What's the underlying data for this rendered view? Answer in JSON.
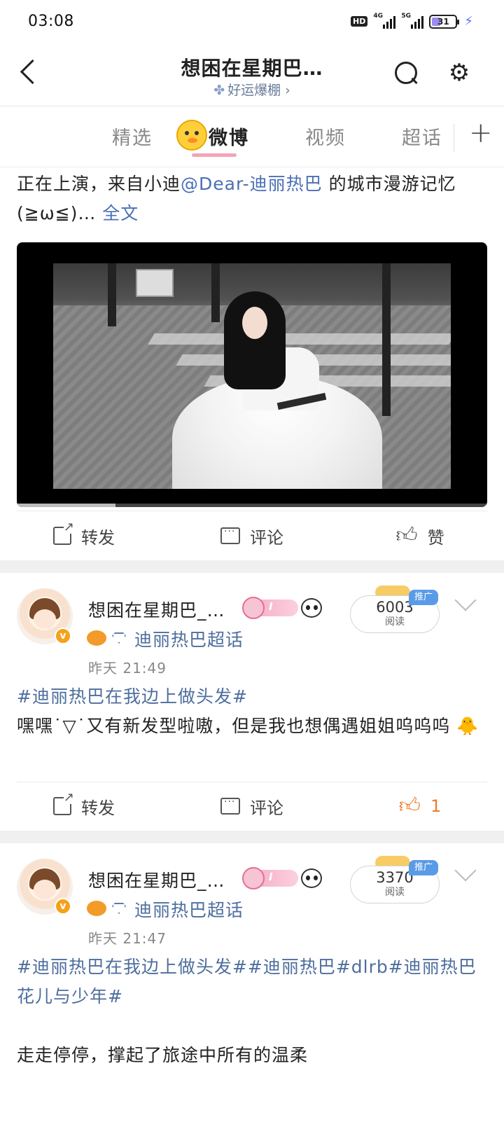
{
  "status_bar": {
    "time": "03:08",
    "hd": "HD",
    "net1": "4G",
    "net2": "5G",
    "battery": "31"
  },
  "header": {
    "title": "想困在星期巴…",
    "subtitle": "好运爆棚 ›"
  },
  "tabs": [
    {
      "label": "精选"
    },
    {
      "label": "微博"
    },
    {
      "label": "视频"
    },
    {
      "label": "超话"
    }
  ],
  "post1": {
    "text_before": "正在上演，来自小迪",
    "mention": "@Dear-迪丽热巴",
    "text_after": " 的城市漫游记忆(≧ω≦)…",
    "full_text": " 全文",
    "video_progress": 0.21,
    "actions": {
      "share": "转发",
      "comment": "评论",
      "like": "赞"
    }
  },
  "post2": {
    "username": "想困在星期巴_…",
    "level": "I",
    "supertopic": "迪丽热巴超话",
    "time": "昨天 21:49",
    "read_count": "6003",
    "read_label": "阅读",
    "promo": "推广",
    "topic": "#迪丽热巴在我边上做头发#",
    "text": "嘿嘿˙▽˙又有新发型啦嗷，但是我也想偶遇姐姐呜呜呜",
    "actions": {
      "share": "转发",
      "comment": "评论",
      "like_count": "1"
    }
  },
  "post3": {
    "username": "想困在星期巴_…",
    "level": "I",
    "supertopic": "迪丽热巴超话",
    "time": "昨天 21:47",
    "read_count": "3370",
    "read_label": "阅读",
    "promo": "推广",
    "topics": "#迪丽热巴在我边上做头发##迪丽热巴#dlrb#迪丽热巴花儿与少年#",
    "text": "走走停停，撑起了旅途中所有的温柔"
  }
}
